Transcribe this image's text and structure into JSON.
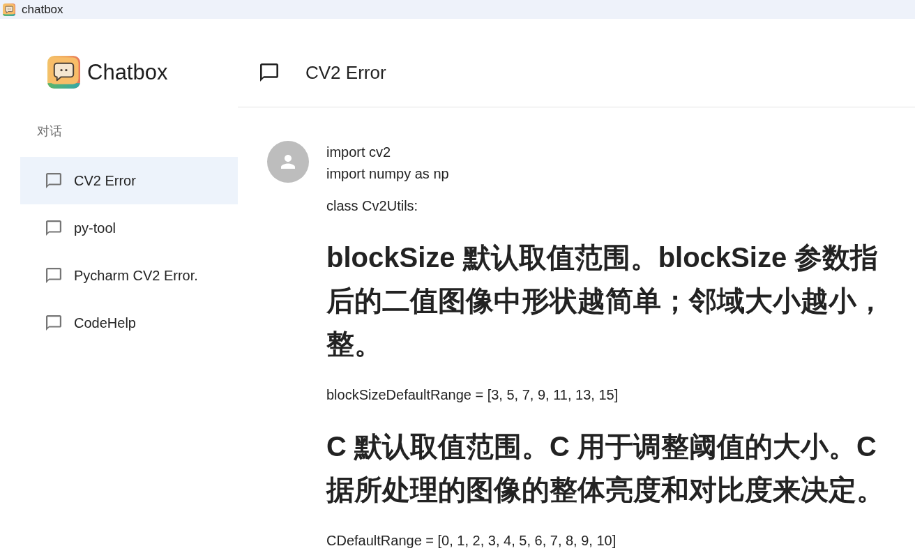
{
  "window": {
    "title": "chatbox"
  },
  "sidebar": {
    "app_name": "Chatbox",
    "section_label": "对话",
    "items": [
      {
        "label": "CV2 Error",
        "selected": true
      },
      {
        "label": "py-tool",
        "selected": false
      },
      {
        "label": "Pycharm CV2 Error.",
        "selected": false
      },
      {
        "label": "CodeHelp",
        "selected": false
      }
    ]
  },
  "header": {
    "title": "CV2 Error"
  },
  "messages": [
    {
      "blocks": [
        {
          "kind": "paragraph",
          "lines": [
            "import cv2",
            "import numpy as np"
          ]
        },
        {
          "kind": "paragraph",
          "lines": [
            "class Cv2Utils:"
          ]
        },
        {
          "kind": "heading",
          "lines": [
            "blockSize 默认取值范围。blockSize 参数指",
            "后的二值图像中形状越简单；邻域大小越小，",
            "整。"
          ]
        },
        {
          "kind": "paragraph",
          "lines": [
            "blockSizeDefaultRange = [3, 5, 7, 9, 11, 13, 15]"
          ]
        },
        {
          "kind": "heading",
          "lines": [
            "C 默认取值范围。C 用于调整阈值的大小。C",
            "据所处理的图像的整体亮度和对比度来决定。"
          ]
        },
        {
          "kind": "paragraph",
          "lines": [
            "CDefaultRange = [0, 1, 2, 3, 4, 5, 6, 7, 8, 9, 10]"
          ]
        }
      ]
    }
  ]
}
